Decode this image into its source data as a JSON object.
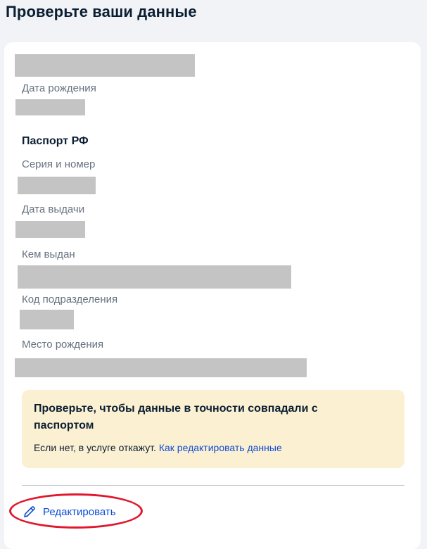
{
  "page": {
    "title": "Проверьте ваши данные"
  },
  "person": {
    "birth_date_label": "Дата рождения"
  },
  "passport": {
    "section_title": "Паспорт РФ",
    "series_number_label": "Серия и номер",
    "issue_date_label": "Дата выдачи",
    "issued_by_label": "Кем выдан",
    "division_code_label": "Код подразделения",
    "birth_place_label": "Место рождения"
  },
  "notice": {
    "title": "Проверьте, чтобы данные в точности совпадали с паспортом",
    "text": "Если нет, в услуге откажут.",
    "link": "Как редактировать данные"
  },
  "actions": {
    "edit_label": "Редактировать",
    "edit_icon": "pencil-icon"
  },
  "colors": {
    "link": "#0d4cd3",
    "notice_bg": "#fcf0d2",
    "highlight": "#e0182d",
    "redaction": "#c4c4c4"
  }
}
